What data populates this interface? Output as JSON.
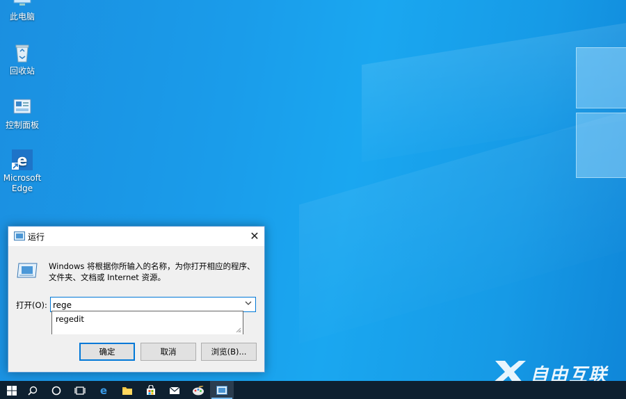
{
  "desktop": {
    "icons": [
      {
        "label": "此电脑",
        "icon": "this-pc-icon"
      },
      {
        "label": "回收站",
        "icon": "recycle-bin-icon"
      },
      {
        "label": "控制面板",
        "icon": "control-panel-icon"
      },
      {
        "label": "Microsoft Edge",
        "icon": "edge-icon"
      }
    ],
    "background": "#1a9cea"
  },
  "run_dialog": {
    "title": "运行",
    "description": "Windows 将根据你所输入的名称，为你打开相应的程序、文件夹、文档或 Internet 资源。",
    "open_label": "打开(O):",
    "input_value": "rege",
    "suggestion": "regedit",
    "ok_label": "确定",
    "cancel_label": "取消",
    "browse_label": "浏览(B)...",
    "close_glyph": "✕",
    "accent": "#0078d7"
  },
  "taskbar": {
    "items": [
      "start-icon",
      "search-icon",
      "cortana-icon",
      "task-view-icon",
      "edge-icon",
      "file-explorer-icon",
      "store-icon",
      "mail-icon",
      "paint-icon",
      "run-icon"
    ],
    "active": "run-icon"
  },
  "watermark": {
    "text": "自由互联"
  }
}
